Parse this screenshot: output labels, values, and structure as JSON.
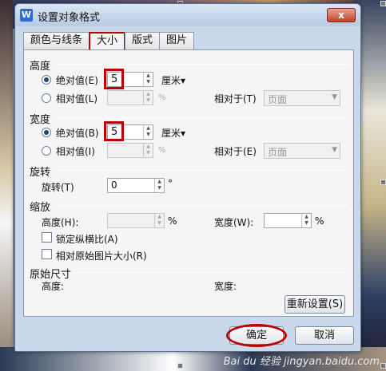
{
  "dialog": {
    "title": "设置对象格式",
    "app_icon": "W",
    "close_label": "x"
  },
  "tabs": [
    "颜色与线条",
    "大小",
    "版式",
    "图片"
  ],
  "size_tab": {
    "height": {
      "section": "高度",
      "absolute_label": "绝对值(E)",
      "absolute_value": "5",
      "unit": "厘米▾",
      "relative_label": "相对值(L)",
      "relative_value": "",
      "percent": "%",
      "relative_to_label": "相对于(T)",
      "relative_to_value": "页面"
    },
    "width": {
      "section": "宽度",
      "absolute_label": "绝对值(B)",
      "absolute_value": "5",
      "unit": "厘米▾",
      "relative_label": "相对值(I)",
      "relative_value": "",
      "percent": "%",
      "relative_to_label": "相对于(E)",
      "relative_to_value": "页面"
    },
    "rotation": {
      "section": "旋转",
      "label": "旋转(T)",
      "value": "0",
      "unit": "°"
    },
    "scale": {
      "section": "缩放",
      "height_label": "高度(H):",
      "height_value": "",
      "width_label": "宽度(W):",
      "width_value": "",
      "percent": "%",
      "lock_ratio_label": "锁定纵横比(A)",
      "relative_original_label": "相对原始图片大小(R)"
    },
    "original": {
      "section": "原始尺寸",
      "height_label": "高度:",
      "width_label": "宽度:",
      "reset_button": "重新设置(S)"
    }
  },
  "footer": {
    "ok_label": "确定",
    "cancel_label": "取消"
  },
  "watermark": "Bai du 经验 jingyan.baidu.com"
}
